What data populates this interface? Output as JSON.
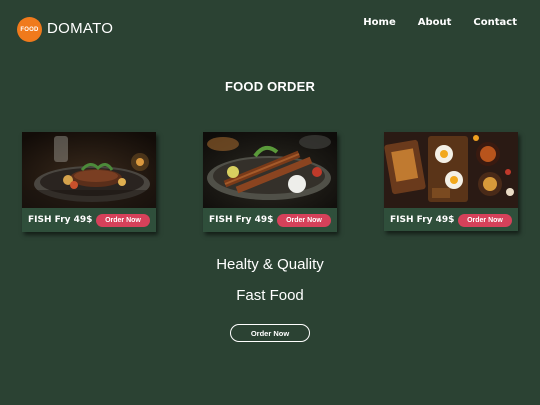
{
  "brand": {
    "badge_text": "FOOD",
    "name": "DOMATO",
    "badge_color": "#f07a1c"
  },
  "nav": {
    "items": [
      {
        "label": "Home"
      },
      {
        "label": "About"
      },
      {
        "label": "Contact"
      }
    ]
  },
  "section_title": "FOOD ORDER",
  "cards": [
    {
      "label": "FISH Fry 49$",
      "button": "Order Now",
      "image": "grilled-steak-plate"
    },
    {
      "label": "FISH Fry 49$",
      "button": "Order Now",
      "image": "kebab-skewers-plate"
    },
    {
      "label": "FISH Fry 49$",
      "button": "Order Now",
      "image": "breakfast-spread-table"
    }
  ],
  "taglines": {
    "line1": "Healty & Quality",
    "line2": "Fast Food"
  },
  "cta": {
    "label": "Order Now"
  },
  "colors": {
    "background": "#2b4233",
    "accent": "#d6415a",
    "card": "#2f4f3b"
  }
}
